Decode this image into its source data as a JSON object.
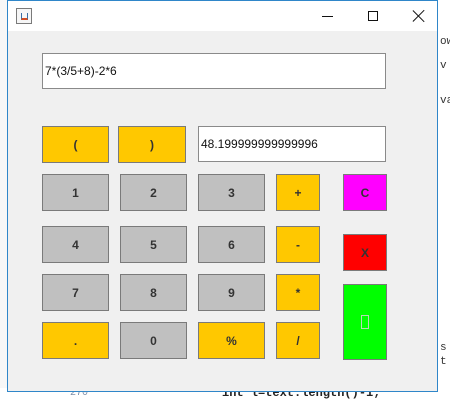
{
  "background": {
    "right_text_1": "ow",
    "right_text_2": "v",
    "right_text_3": "va",
    "right_text_4": "s",
    "right_text_5": "t",
    "line_number": "270",
    "code_line": "int l=text.length()-1;"
  },
  "window": {
    "icon": "java-icon",
    "controls": {
      "minimize": "minimize-icon",
      "maximize": "maximize-icon",
      "close": "close-icon"
    }
  },
  "expression_field": {
    "value": "7*(3/5+8)-2*6"
  },
  "result_field": {
    "value": "48.199999999999996"
  },
  "buttons": {
    "open_paren": "(",
    "close_paren": ")",
    "one": "1",
    "two": "2",
    "three": "3",
    "four": "4",
    "five": "5",
    "six": "6",
    "seven": "7",
    "eight": "8",
    "nine": "9",
    "dot": ".",
    "zero": "0",
    "percent": "%",
    "plus": "+",
    "minus": "-",
    "multiply": "*",
    "divide": "/",
    "clear": "C",
    "delete": "X"
  },
  "colors": {
    "digit": "#c0c0c0",
    "operator": "#ffc800",
    "clear": "#ff00ff",
    "delete": "#ff0000",
    "equals": "#00ff00",
    "window_border": "#2f86c9"
  }
}
